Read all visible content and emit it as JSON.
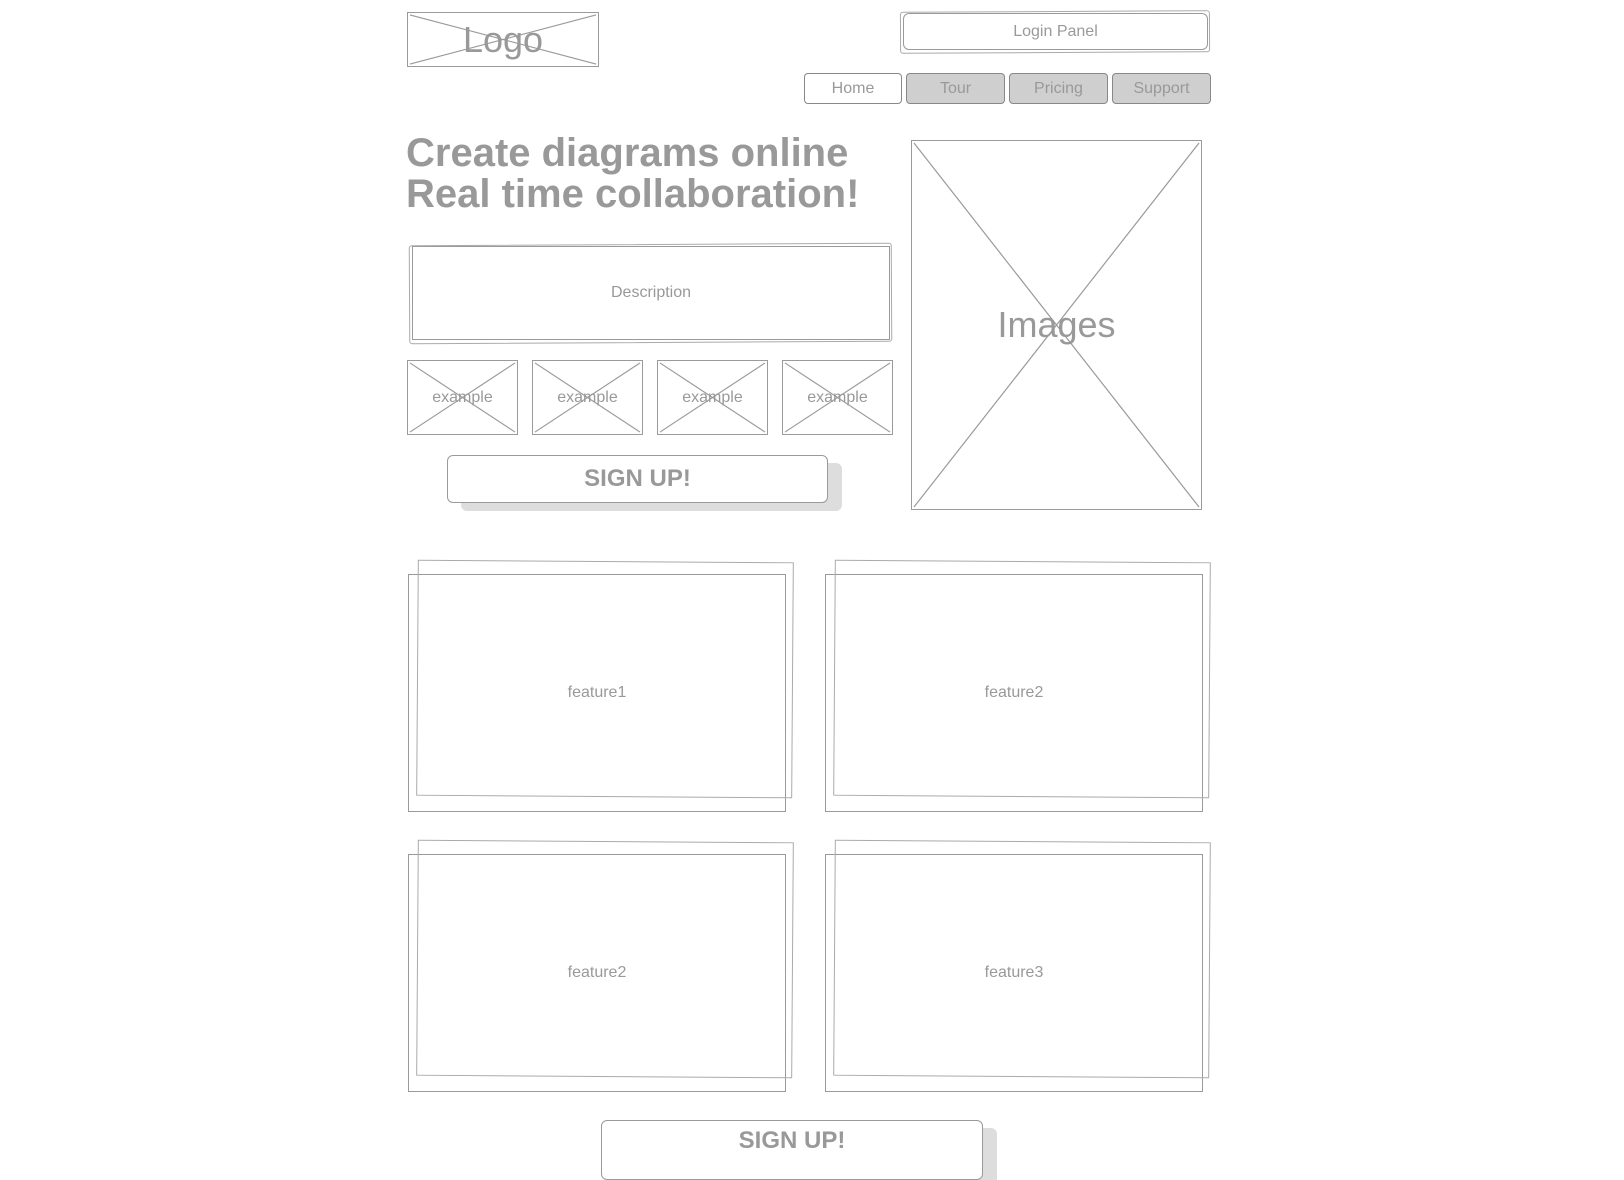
{
  "header": {
    "logo_label": "Logo",
    "login_panel_label": "Login Panel"
  },
  "nav": {
    "items": [
      {
        "label": "Home",
        "state": "active"
      },
      {
        "label": "Tour",
        "state": "inactive"
      },
      {
        "label": "Pricing",
        "state": "inactive"
      },
      {
        "label": "Support",
        "state": "inactive"
      }
    ]
  },
  "hero": {
    "headline_line1": "Create diagrams online",
    "headline_line2": "Real time collaboration!",
    "description_label": "Description",
    "examples": [
      "example",
      "example",
      "example",
      "example"
    ],
    "signup_label": "SIGN UP!",
    "images_label": "Images"
  },
  "features": [
    {
      "label": "feature1"
    },
    {
      "label": "feature2"
    },
    {
      "label": "feature2"
    },
    {
      "label": "feature3"
    }
  ],
  "footer": {
    "signup_label": "SIGN UP!"
  }
}
